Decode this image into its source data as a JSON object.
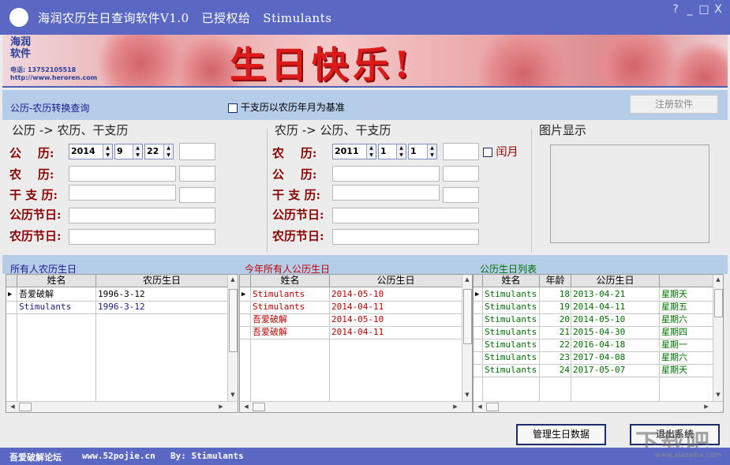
{
  "window": {
    "title": "海润农历生日查询软件V1.0   已授权给   Stimulants",
    "controls": [
      "?",
      "_",
      "□",
      "X"
    ]
  },
  "banner": {
    "logo_line1": "海润",
    "logo_line2": "软件",
    "phone": "电话: 13752105518",
    "url": "http://www.heroren.com",
    "slogan": "生日快乐!"
  },
  "conversion": {
    "header": "公历-农历转换查询",
    "ganzhi_checkbox": "干支历以农历年月为基准",
    "register_button": "注册软件",
    "solar_section": {
      "title": "公历 -> 农历、干支历",
      "labels": {
        "solar": "公    历:",
        "lunar": "农    历:",
        "ganzhi": "干 支 历:",
        "solar_holiday": "公历节日:",
        "lunar_holiday": "农历节日:"
      },
      "year": "2014",
      "month": "9",
      "day": "22"
    },
    "lunar_section": {
      "title": "农历 -> 公历、干支历",
      "labels": {
        "lunar": "农    历:",
        "solar": "公    历:",
        "ganzhi": "干 支 历:",
        "solar_holiday": "公历节日:",
        "lunar_holiday": "农历节日:"
      },
      "year": "2011",
      "month": "1",
      "day": "1",
      "leap_checkbox": "闰月"
    },
    "picture_section": {
      "title": "图片显示"
    }
  },
  "lists": {
    "all_lunar": {
      "title": "所有人农历生日",
      "columns": [
        "姓名",
        "农历生日"
      ],
      "rows": [
        [
          "吾爱破解",
          "1996-3-12"
        ],
        [
          "Stimulants",
          "1996-3-12"
        ]
      ]
    },
    "this_year_solar": {
      "title": "今年所有人公历生日",
      "columns": [
        "姓名",
        "公历生日"
      ],
      "rows": [
        [
          "Stimulants",
          "2014-05-10"
        ],
        [
          "Stimulants",
          "2014-04-11"
        ],
        [
          "吾爱破解",
          "2014-05-10"
        ],
        [
          "吾爱破解",
          "2014-04-11"
        ]
      ]
    },
    "solar_list": {
      "title": "公历生日列表",
      "columns": [
        "姓名",
        "年龄",
        "公历生日",
        ""
      ],
      "rows": [
        [
          "Stimulants",
          "18",
          "2013-04-21",
          "星期天"
        ],
        [
          "Stimulants",
          "19",
          "2014-04-11",
          "星期五"
        ],
        [
          "Stimulants",
          "20",
          "2014-05-10",
          "星期六"
        ],
        [
          "Stimulants",
          "21",
          "2015-04-30",
          "星期四"
        ],
        [
          "Stimulants",
          "22",
          "2016-04-18",
          "星期一"
        ],
        [
          "Stimulants",
          "23",
          "2017-04-08",
          "星期六"
        ],
        [
          "Stimulants",
          "24",
          "2017-05-07",
          "星期天"
        ]
      ]
    }
  },
  "buttons": {
    "manage": "管理生日数据",
    "exit": "退出系统"
  },
  "status": {
    "forum": "吾爱破解论坛",
    "site": "www.52pojie.cn",
    "by": "By: Stimulants"
  },
  "watermark": {
    "text": "下载吧",
    "url": "www.xiazaiba.com"
  },
  "colors": {
    "titlebar": "#5a67c3",
    "strip": "#b6cdea",
    "label_red": "#8b0000",
    "list1_text": "#1a1a8c",
    "list2_text": "#c00000",
    "list3_text": "#007000"
  }
}
